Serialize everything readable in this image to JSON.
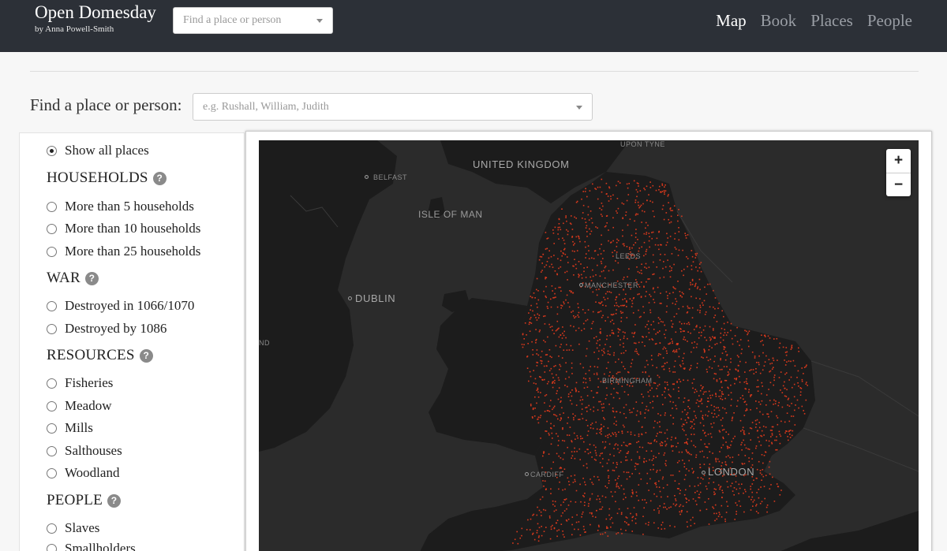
{
  "brand": {
    "title": "Open Domesday",
    "subtitle": "by Anna Powell-Smith"
  },
  "nav_search": {
    "placeholder": "Find a place or person"
  },
  "nav": [
    {
      "label": "Map",
      "active": true
    },
    {
      "label": "Book",
      "active": false
    },
    {
      "label": "Places",
      "active": false
    },
    {
      "label": "People",
      "active": false
    }
  ],
  "find": {
    "label": "Find a place or person:",
    "placeholder": "e.g. Rushall, William, Judith"
  },
  "filters": {
    "show_all": "Show all places",
    "households": {
      "title": "HOUSEHOLDS",
      "options": [
        "More than 5 households",
        "More than 10 households",
        "More than 25 households"
      ]
    },
    "war": {
      "title": "WAR",
      "options": [
        "Destroyed in 1066/1070",
        "Destroyed by 1086"
      ]
    },
    "resources": {
      "title": "RESOURCES",
      "options": [
        "Fisheries",
        "Meadow",
        "Mills",
        "Salthouses",
        "Woodland"
      ]
    },
    "people": {
      "title": "PEOPLE",
      "options": [
        "Slaves",
        "Smallholders"
      ]
    },
    "help_glyph": "?"
  },
  "map": {
    "labels": {
      "united_kingdom": "UNITED KINGDOM",
      "upon_tyne": "UPON TYNE",
      "belfast": "BELFAST",
      "isle_of_man": "ISLE OF MAN",
      "leeds": "LEEDS",
      "manchester": "MANCHESTER",
      "dublin": "DUBLIN",
      "nd": "ND",
      "birmingham": "BIRMINGHAM",
      "cardiff": "CARDIFF",
      "london": "LONDON"
    },
    "zoom_in": "+",
    "zoom_out": "−",
    "colors": {
      "land": "#1c1c1c",
      "sea": "#2b2b2b",
      "places": "#d9391c"
    }
  }
}
